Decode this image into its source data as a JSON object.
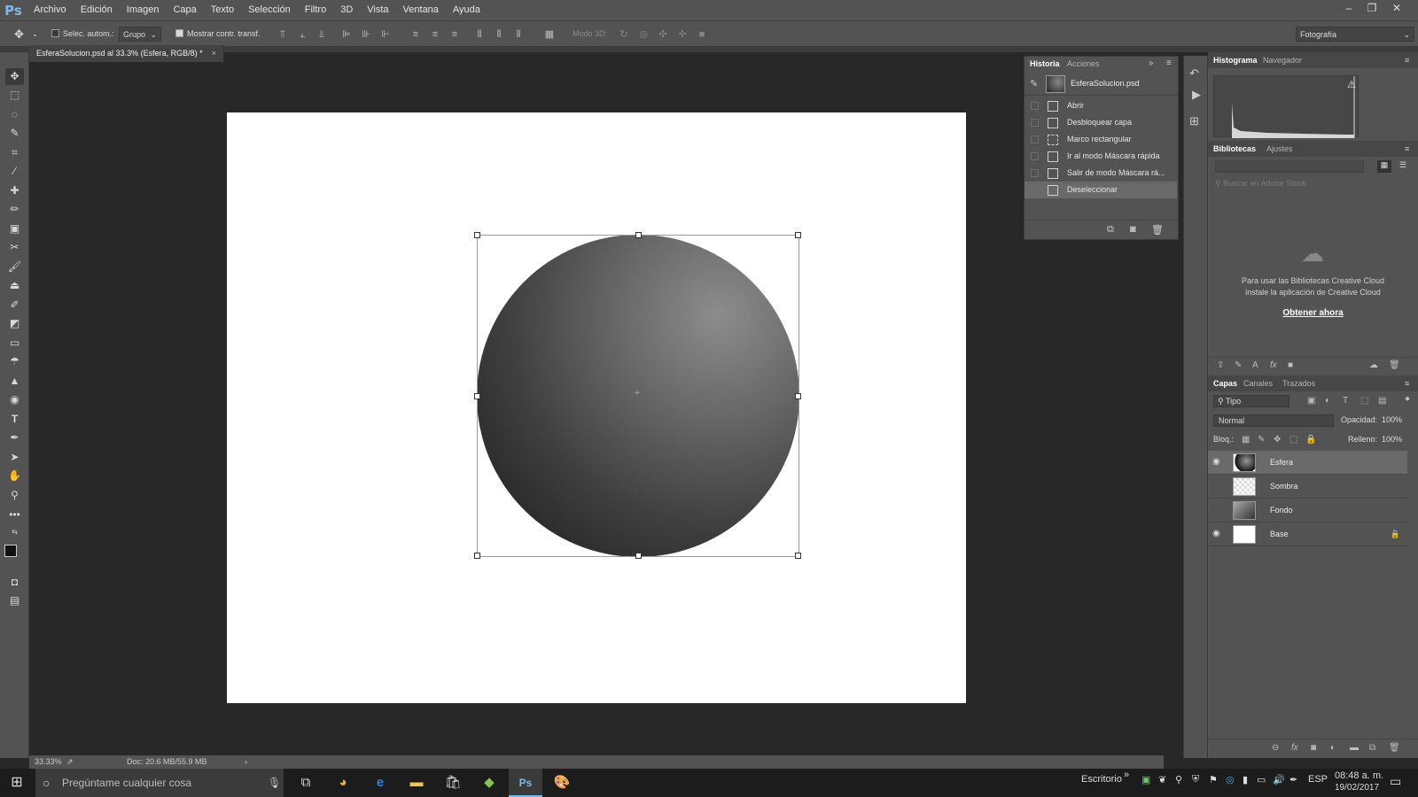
{
  "menubar": {
    "logo": "Ps",
    "items": [
      "Archivo",
      "Edición",
      "Imagen",
      "Capa",
      "Texto",
      "Selección",
      "Filtro",
      "3D",
      "Vista",
      "Ventana",
      "Ayuda"
    ],
    "window_controls": {
      "minimize": "–",
      "restore": "❐",
      "close": "✕"
    }
  },
  "options_bar": {
    "auto_select_label": "Selec. autom.:",
    "auto_select_checked": false,
    "group_value": "Grupo",
    "show_transform_label": "Mostrar contr. transf.",
    "show_transform_checked": true,
    "mode3d_label": "Modo 3D:",
    "workspace_value": "Fotografía"
  },
  "document": {
    "tab_title": "EsferaSolucion.psd al 33.3% (Esfera, RGB/8) *",
    "tab_close": "×",
    "zoom": "33.33%",
    "doc_size": "Doc: 20.6 MB/55.9 MB",
    "status_arrow": "›"
  },
  "history_panel": {
    "tabs": [
      "Historia",
      "Acciones"
    ],
    "snapshot_name": "EsferaSolucion.psd",
    "items": [
      {
        "label": "Abrir",
        "icon": "doc-icon"
      },
      {
        "label": "Desbloquear capa",
        "icon": "doc-icon"
      },
      {
        "label": "Marco rectangular",
        "icon": "marquee-icon"
      },
      {
        "label": "Ir al modo Máscara rápida",
        "icon": "doc-icon"
      },
      {
        "label": "Salir de modo Máscara rá...",
        "icon": "doc-icon"
      },
      {
        "label": "Deseleccionar",
        "icon": "doc-icon",
        "selected": true
      }
    ]
  },
  "histogram_panel": {
    "tabs": [
      "Histograma",
      "Navegador"
    ]
  },
  "libraries_panel": {
    "tabs": [
      "Bibliotecas",
      "Ajustes"
    ],
    "search_placeholder": "Buscar en Adobe Stock",
    "message_line1": "Para usar las Bibliotecas Creative Cloud",
    "message_line2": "instale la aplicación de Creative Cloud",
    "cta": "Obtener ahora"
  },
  "layers_panel": {
    "tabs": [
      "Capas",
      "Canales",
      "Trazados"
    ],
    "filter_value": "Tipo",
    "blend_mode": "Normal",
    "opacity_label": "Opacidad:",
    "opacity_value": "100%",
    "lock_label": "Bloq.:",
    "fill_label": "Relleno:",
    "fill_value": "100%",
    "layers": [
      {
        "name": "Esfera",
        "visible": true,
        "selected": true
      },
      {
        "name": "Sombra",
        "visible": false
      },
      {
        "name": "Fondo",
        "visible": false
      },
      {
        "name": "Base",
        "visible": true,
        "locked": true
      }
    ]
  },
  "taskbar": {
    "search_placeholder": "Pregúntame cualquier cosa",
    "desktop_label": "Escritorio",
    "desktop_chevron": "»",
    "lang": "ESP",
    "time": "08:48 a. m.",
    "date": "19/02/2017"
  },
  "colors": {
    "accent": "#76b9ed",
    "panel": "#535353",
    "canvas_bg": "#282828"
  }
}
